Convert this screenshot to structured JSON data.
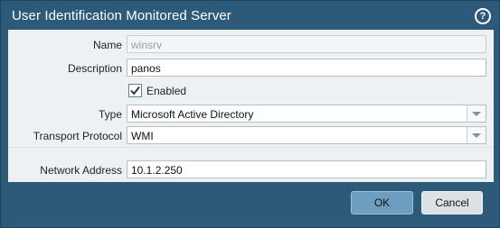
{
  "dialog": {
    "title": "User Identification Monitored Server",
    "help_icon": "question-mark-circle-icon"
  },
  "form": {
    "name": {
      "label": "Name",
      "value": "winsrv",
      "disabled": true
    },
    "description": {
      "label": "Description",
      "value": "panos"
    },
    "enabled": {
      "label": "Enabled",
      "checked": true
    },
    "type": {
      "label": "Type",
      "value": "Microsoft Active Directory"
    },
    "transport_protocol": {
      "label": "Transport Protocol",
      "value": "WMI"
    },
    "network_address": {
      "label": "Network Address",
      "value": "10.1.2.250"
    }
  },
  "buttons": {
    "ok_label": "OK",
    "cancel_label": "Cancel"
  },
  "colors": {
    "frame": "#2e5a7a",
    "body": "#eef1f3",
    "ok_button": "#6d9ec0",
    "cancel_button": "#dbe2e6"
  }
}
